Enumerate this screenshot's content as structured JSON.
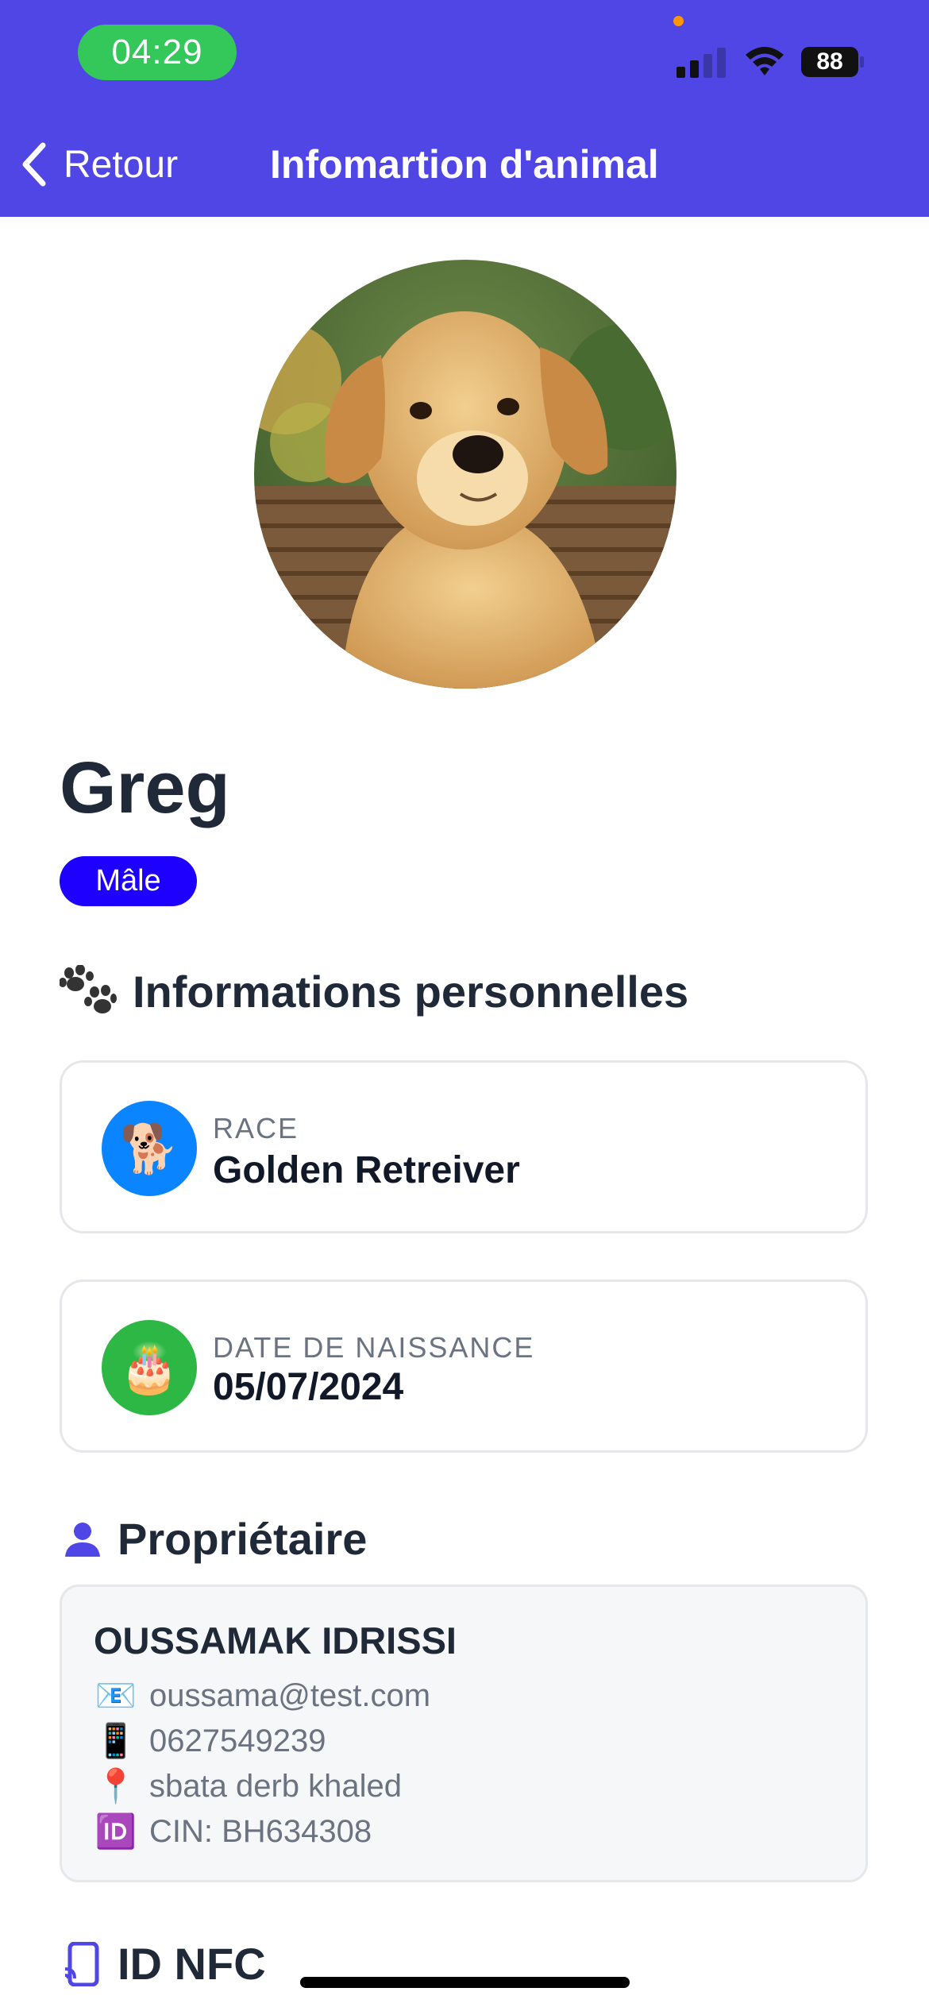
{
  "status_bar": {
    "time": "04:29",
    "battery": "88"
  },
  "nav": {
    "back_label": "Retour",
    "title": "Infomartion d'animal"
  },
  "pet": {
    "name": "Greg",
    "gender": "Mâle"
  },
  "personal_section": {
    "title": "Informations personnelles",
    "icon": "paw-prints-icon",
    "cards": [
      {
        "label": "RACE",
        "value": "Golden Retreiver",
        "icon": "dog-emoji",
        "emoji": "🐕",
        "color": "#0a84ff"
      },
      {
        "label": "DATE DE NAISSANCE",
        "value": "05/07/2024",
        "icon": "birthday-cake-emoji",
        "emoji": "🎂",
        "color": "#2db744"
      }
    ]
  },
  "owner_section": {
    "title": "Propriétaire",
    "icon": "person-icon",
    "name": "OUSSAMAK IDRISSI",
    "email_icon": "📧",
    "email": "oussama@test.com",
    "phone_icon": "📱",
    "phone": "0627549239",
    "address_icon": "📍",
    "address": "sbata derb khaled",
    "cin_icon": "🆔",
    "cin": "CIN: BH634308"
  },
  "nfc_section": {
    "title": "ID NFC",
    "icon": "nfc-phone-icon"
  },
  "colors": {
    "header_bg": "#4f46e5",
    "badge_bg": "#1d00ff",
    "accent": "#4f46e5"
  }
}
